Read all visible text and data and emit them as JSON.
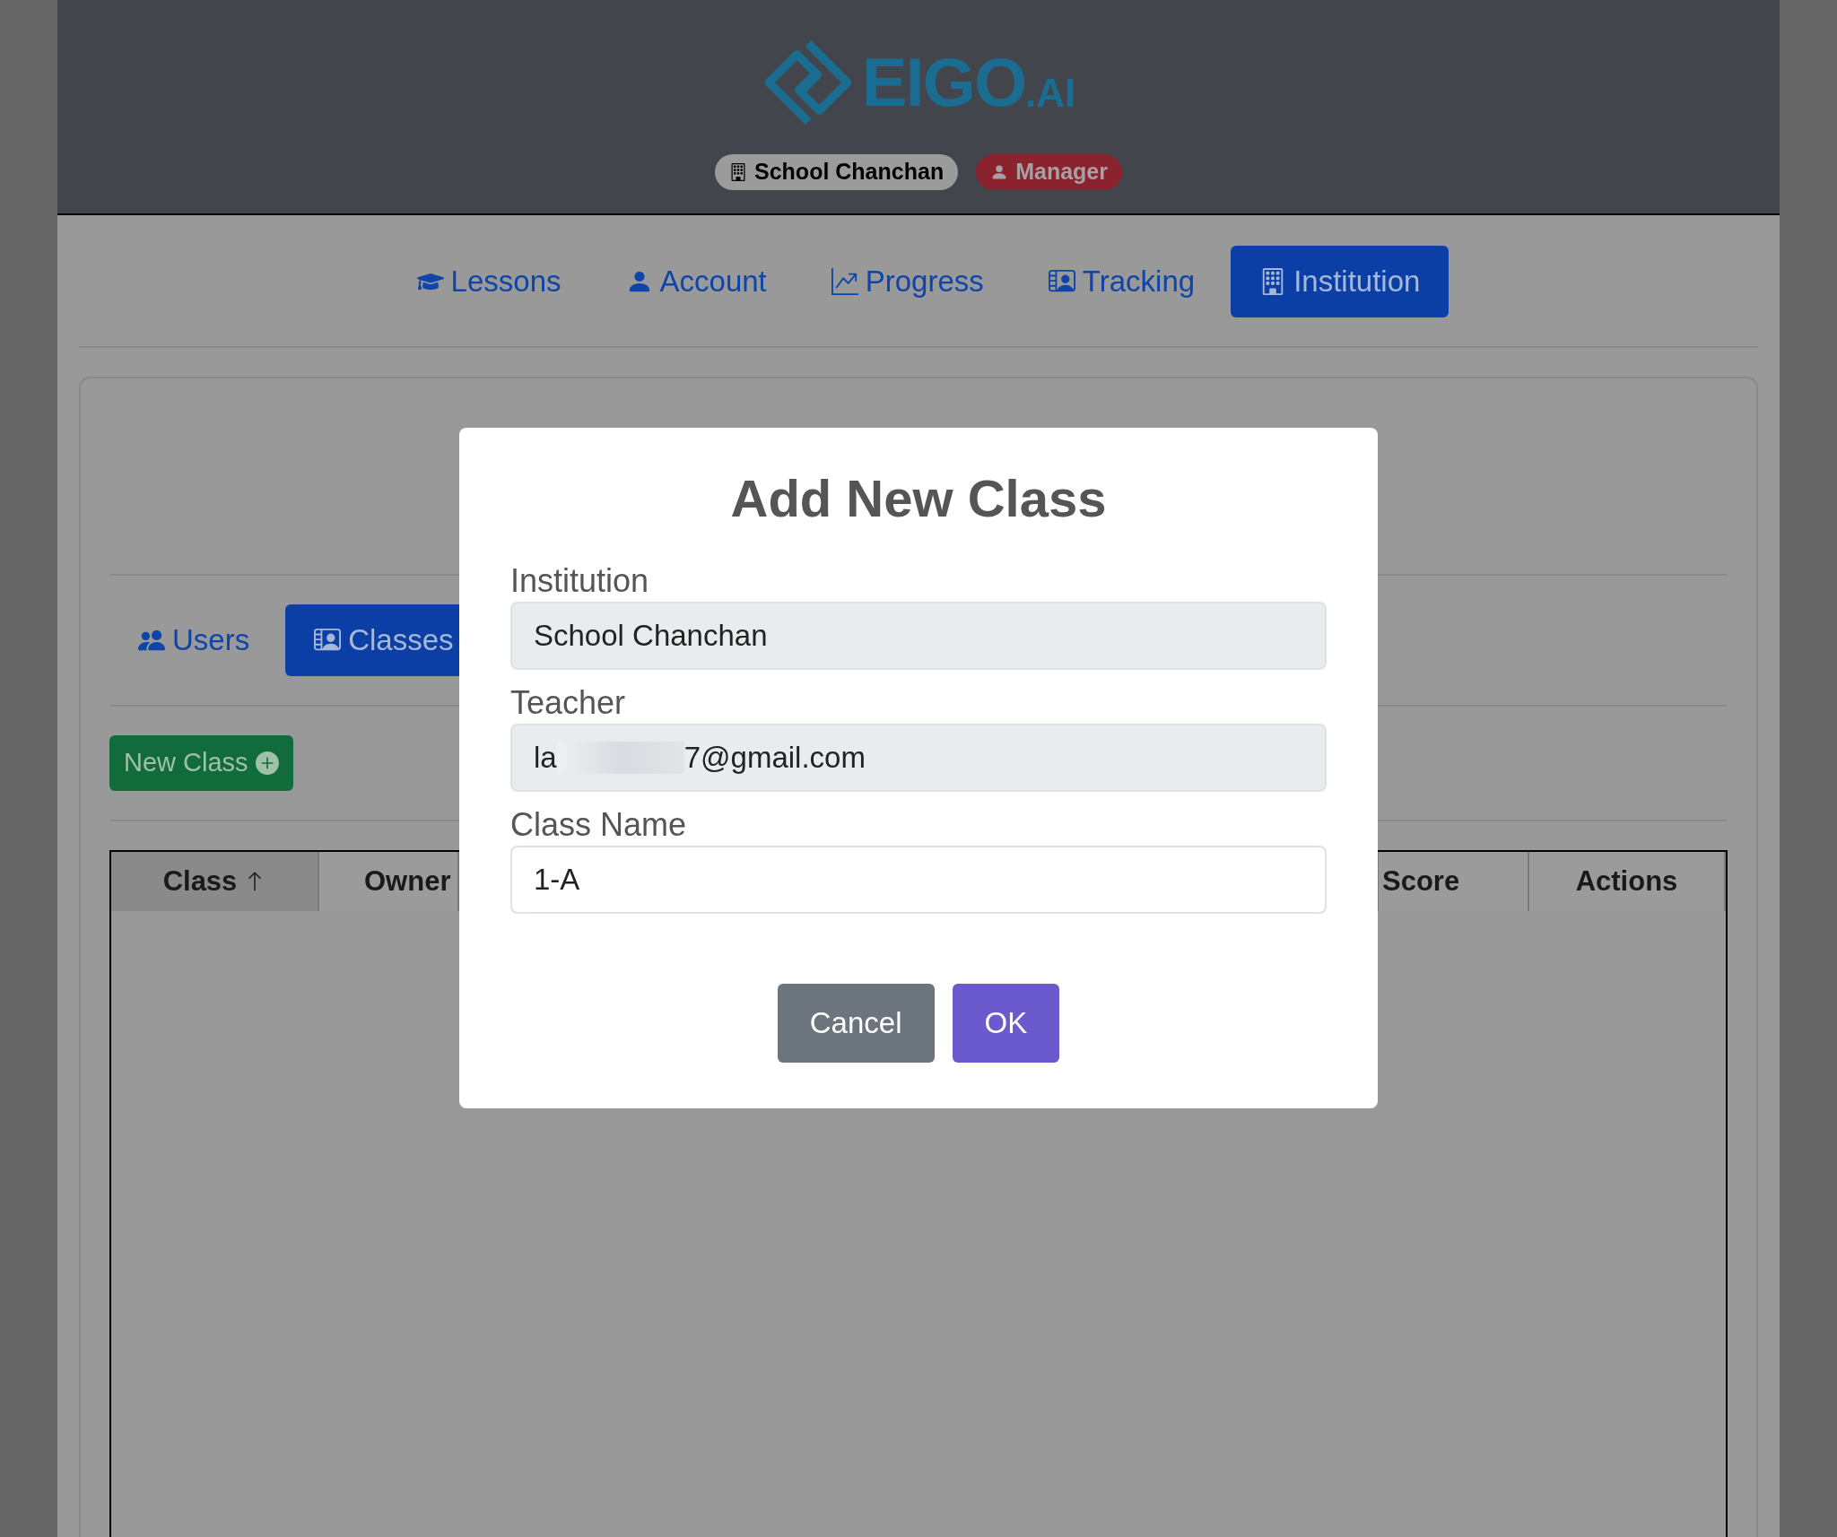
{
  "header": {
    "logo": {
      "name": "EIGO",
      "suffix": ".AI"
    },
    "badges": [
      {
        "kind": "institution",
        "label": "School Chanchan"
      },
      {
        "kind": "role",
        "label": "Manager"
      }
    ]
  },
  "nav": [
    {
      "kind": "lessons",
      "label": "Lessons",
      "selected": false
    },
    {
      "kind": "account",
      "label": "Account",
      "selected": false
    },
    {
      "kind": "progress",
      "label": "Progress",
      "selected": false
    },
    {
      "kind": "tracking",
      "label": "Tracking",
      "selected": false
    },
    {
      "kind": "institution",
      "label": "Institution",
      "selected": true
    }
  ],
  "sub_tabs": [
    {
      "kind": "users",
      "label": "Users",
      "selected": false
    },
    {
      "kind": "classes",
      "label": "Classes",
      "selected": true
    }
  ],
  "new_class_button": "New Class",
  "table": {
    "columns": [
      {
        "label": "Class",
        "sorted": true
      },
      {
        "label": "Owner",
        "sorted": false
      },
      {
        "label": "Score",
        "sorted": false
      },
      {
        "label": "Actions",
        "sorted": false
      }
    ]
  },
  "dialog": {
    "title": "Add New Class",
    "fields": [
      {
        "label": "Institution",
        "value": "School Chanchan",
        "disabled": true,
        "redacted": false
      },
      {
        "label": "Teacher",
        "value": "la",
        "value_end": "7@gmail.com",
        "disabled": true,
        "redacted": true
      },
      {
        "label": "Class Name",
        "value": "1-A",
        "disabled": false,
        "redacted": false
      }
    ],
    "buttons": [
      {
        "kind": "cancel",
        "label": "Cancel"
      },
      {
        "kind": "ok",
        "label": "OK"
      }
    ]
  }
}
